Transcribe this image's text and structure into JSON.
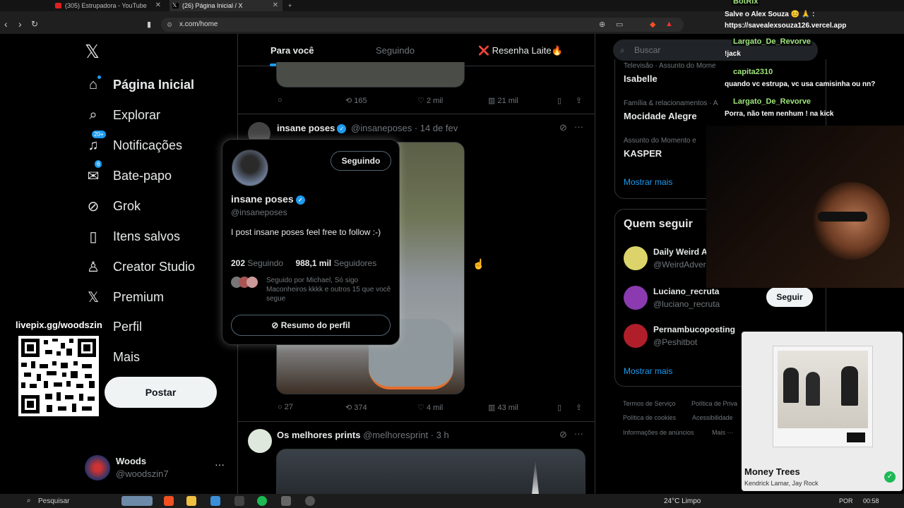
{
  "browser": {
    "tabs": [
      {
        "label": "(305) Estrupadora - YouTube"
      },
      {
        "label": "(26) Página Inicial / X"
      }
    ],
    "new_tab": "+",
    "url": "x.com/home"
  },
  "left_nav": {
    "items": [
      {
        "label": "Página Inicial",
        "icon": "home-icon"
      },
      {
        "label": "Explorar",
        "icon": "search-icon"
      },
      {
        "label": "Notificações",
        "icon": "bell-icon",
        "badge": "20+"
      },
      {
        "label": "Bate-papo",
        "icon": "mail-icon",
        "badge": "6"
      },
      {
        "label": "Grok",
        "icon": "grok-icon"
      },
      {
        "label": "Itens salvos",
        "icon": "bookmark-icon"
      },
      {
        "label": "Creator Studio",
        "icon": "creator-icon"
      },
      {
        "label": "Premium",
        "icon": "x-logo-icon"
      },
      {
        "label": "Perfil",
        "icon": "person-icon"
      },
      {
        "label": "Mais",
        "icon": "more-icon"
      }
    ],
    "post_button": "Postar",
    "account": {
      "name": "Woods",
      "handle": "@woodszin7"
    }
  },
  "overlay": {
    "livepix": "livepix.gg/woodszin"
  },
  "feed": {
    "tabs": [
      "Para você",
      "Seguindo",
      "❌ Resenha Laite🔥"
    ],
    "post1_actions": {
      "replies": "",
      "reposts": "165",
      "likes": "2 mil",
      "views": "21 mil"
    },
    "post2": {
      "name": "insane poses",
      "handle": "@insaneposes",
      "date": "14 de fev",
      "actions": {
        "replies": "27",
        "reposts": "374",
        "likes": "4 mil",
        "views": "43 mil"
      }
    },
    "post3": {
      "name": "Os melhores prints",
      "handle": "@melhoresprint",
      "date": "3 h"
    }
  },
  "hovercard": {
    "follow_label": "Seguindo",
    "name": "insane poses",
    "handle": "@insaneposes",
    "bio": "I post insane poses feel free to follow :-)",
    "following_count": "202",
    "following_label": "Seguindo",
    "followers_count": "988,1 mil",
    "followers_label": "Seguidores",
    "followed_by": "Seguido por Michael, Só sigo Maconheiros kkkk e outros 15 que você segue",
    "summary_button": "Resumo do perfil"
  },
  "right": {
    "search_placeholder": "Buscar",
    "trends": [
      {
        "category": "Televisão · Assunto do Momento",
        "name": "Isabelle"
      },
      {
        "category": "Família & relacionamentos · Assunto do Momento",
        "name": "Mocidade Alegre"
      },
      {
        "category": "Assunto do Momento e",
        "name": "KASPER"
      }
    ],
    "trends_more": "Mostrar mais",
    "who_title": "Quem seguir",
    "who": [
      {
        "name": "Daily Weird A",
        "handle": "@WeirdAdver"
      },
      {
        "name": "Luciano_recruta",
        "handle": "@luciano_recruta",
        "button": "Seguir"
      },
      {
        "name": "Pernambucoposting",
        "handle": "@Peshitbot"
      }
    ],
    "who_more": "Mostrar mais",
    "footer": [
      "Termos de Serviço",
      "Política de Priva",
      "Política de cookies",
      "Acessibilidade",
      "Informações de anúncios",
      "Mais ···"
    ]
  },
  "chat": {
    "messages": [
      {
        "user": "BotRix",
        "text": "Salve o Alex Souza 😊 🙏 : https://savealexsouza126.vercel.app"
      },
      {
        "user": "Largato_De_Revorve",
        "text": "!jack"
      },
      {
        "user": "capita2310",
        "text": "quando vc estrupa, vc usa camisinha ou nn?"
      },
      {
        "user": "Largato_De_Revorve",
        "text": "Porra, não tem nenhum ! na kick"
      }
    ]
  },
  "spotify": {
    "title": "Money Trees",
    "artist": "Kendrick Lamar, Jay Rock"
  },
  "taskbar": {
    "search": "Pesquisar",
    "weather": "24°C Limpo",
    "lang": "POR",
    "time": "00:58"
  },
  "colors": {
    "accent": "#1d9bf0",
    "background": "#000000",
    "text": "#e7e9ea",
    "muted": "#71767b"
  }
}
